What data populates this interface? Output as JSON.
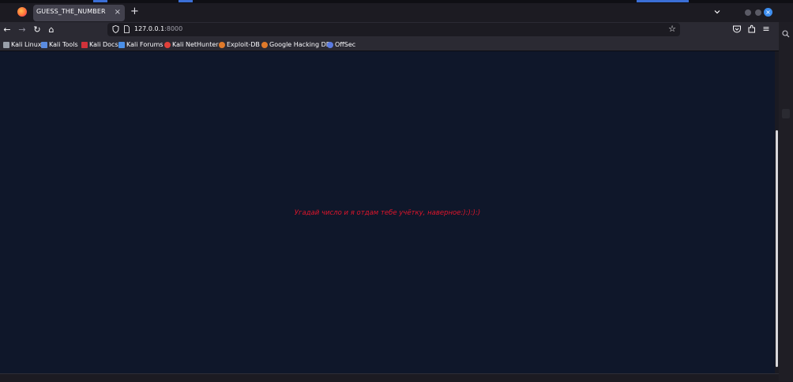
{
  "colors": {
    "tab_bar": "#1c1b22",
    "toolbar": "#2b2a33",
    "page_background": "#0f172a",
    "message_text": "#e0152b",
    "accent": "#3d8ef0"
  },
  "browser": {
    "app_icon": "firefox-icon",
    "tab": {
      "title": "GUESS_THE_NUMBER",
      "close_label": "×"
    },
    "new_tab_label": "+",
    "nav": {
      "back_label": "←",
      "forward_label": "→",
      "reload_label": "↻",
      "home_label": "⌂"
    },
    "url": {
      "host": "127.0.0.1",
      "port": ":8000"
    },
    "bookmark_star": "☆",
    "window_close_label": "×",
    "menu_label": "≡"
  },
  "bookmarks": [
    {
      "label": "Kali Linux",
      "icon": "kali-dragon-icon",
      "color": "#9aa0aa"
    },
    {
      "label": "Kali Tools",
      "icon": "kali-tools-icon",
      "color": "#5a8be0"
    },
    {
      "label": "Kali Docs",
      "icon": "kali-docs-icon",
      "color": "#d0323a"
    },
    {
      "label": "Kali Forums",
      "icon": "kali-forums-icon",
      "color": "#4a8fe8"
    },
    {
      "label": "Kali NetHunter",
      "icon": "nethunter-icon",
      "color": "#e0403a"
    },
    {
      "label": "Exploit-DB",
      "icon": "exploit-db-icon",
      "color": "#e07a2a"
    },
    {
      "label": "Google Hacking DB",
      "icon": "ghdb-icon",
      "color": "#e07a2a"
    },
    {
      "label": "OffSec",
      "icon": "offsec-icon",
      "color": "#5a7ae0"
    }
  ],
  "page": {
    "message": "Угадай число и я отдам тебе учётку, наверное:):):):)"
  }
}
